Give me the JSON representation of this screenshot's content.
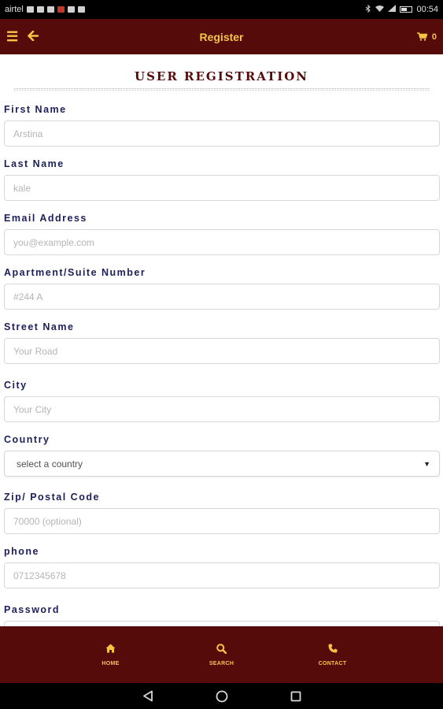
{
  "status_bar": {
    "carrier": "airtel",
    "time": "00:54"
  },
  "header": {
    "title": "Register",
    "cart_count": "0",
    "menu_icon": "menu-icon",
    "back_icon": "arrow-left-icon",
    "cart_icon": "shopping-cart-icon"
  },
  "form": {
    "heading": "USER REGISTRATION",
    "fields": [
      {
        "label": "First Name",
        "placeholder": "Arstina"
      },
      {
        "label": "Last Name",
        "placeholder": "kale"
      },
      {
        "label": "Email Address",
        "placeholder": "you@example.com"
      },
      {
        "label": "Apartment/Suite Number",
        "placeholder": "#244 A"
      },
      {
        "label": "Street Name",
        "placeholder": "Your Road"
      },
      {
        "label": "City",
        "placeholder": "Your City"
      },
      {
        "label": "Country",
        "selected": "select a country"
      },
      {
        "label": "Zip/ Postal Code",
        "placeholder": "70000 (optional)"
      },
      {
        "label": "phone",
        "placeholder": "0712345678"
      },
      {
        "label": "Password",
        "placeholder": ""
      }
    ]
  },
  "bottom_nav": {
    "items": [
      {
        "label": "HOME",
        "icon": "home-icon"
      },
      {
        "label": "SEARCH",
        "icon": "search-icon"
      },
      {
        "label": "CONTACT",
        "icon": "phone-icon"
      }
    ]
  },
  "colors": {
    "header_bg": "#560b0b",
    "accent_gold": "#f4c542",
    "label_navy": "#1c1f5a",
    "heading_maroon": "#560b0b"
  }
}
